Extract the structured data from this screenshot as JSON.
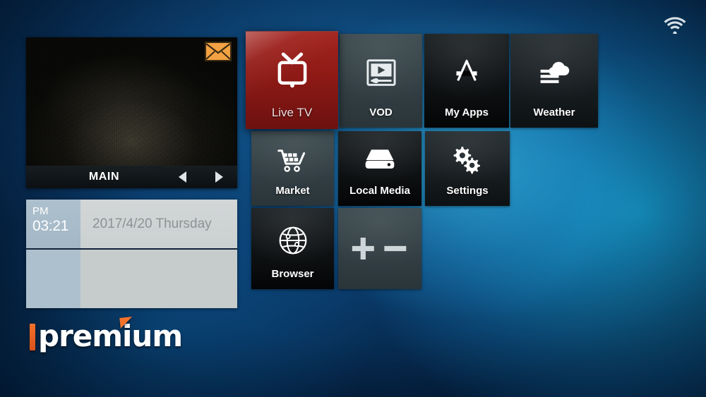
{
  "statusbar": {
    "wifi_icon": "wifi-icon"
  },
  "preview": {
    "label": "MAIN",
    "envelope_icon": "envelope-icon",
    "prev_icon": "triangle-left-icon",
    "next_icon": "triangle-right-icon"
  },
  "clock": {
    "ampm": "PM",
    "time": "03:21",
    "date": "2017/4/20 Thursday"
  },
  "logo": {
    "text": "premium",
    "accent_color": "#f4722a"
  },
  "tiles": [
    {
      "id": "live-tv",
      "label": "Live TV",
      "icon": "tv-icon",
      "style": "red",
      "selected": true
    },
    {
      "id": "vod",
      "label": "VOD",
      "icon": "video-player-icon",
      "style": "slate",
      "selected": false
    },
    {
      "id": "my-apps",
      "label": "My Apps",
      "icon": "app-store-icon",
      "style": "black",
      "selected": false
    },
    {
      "id": "weather",
      "label": "Weather",
      "icon": "cloud-icon",
      "style": "dark",
      "selected": false
    },
    {
      "id": "market",
      "label": "Market",
      "icon": "shopping-cart-icon",
      "style": "slate",
      "selected": false
    },
    {
      "id": "local-media",
      "label": "Local Media",
      "icon": "hard-drive-icon",
      "style": "black",
      "selected": false
    },
    {
      "id": "settings",
      "label": "Settings",
      "icon": "gears-icon",
      "style": "dark",
      "selected": false
    },
    {
      "id": "browser",
      "label": "Browser",
      "icon": "globe-icon",
      "style": "black",
      "selected": false
    },
    {
      "id": "add-remove",
      "label": "",
      "icon": "plus-minus-icon",
      "style": "slate",
      "selected": false
    }
  ],
  "colors": {
    "accent_red": "#8e1a16",
    "background_blue": "#0b3e6f",
    "envelope_orange": "#f2a243"
  }
}
